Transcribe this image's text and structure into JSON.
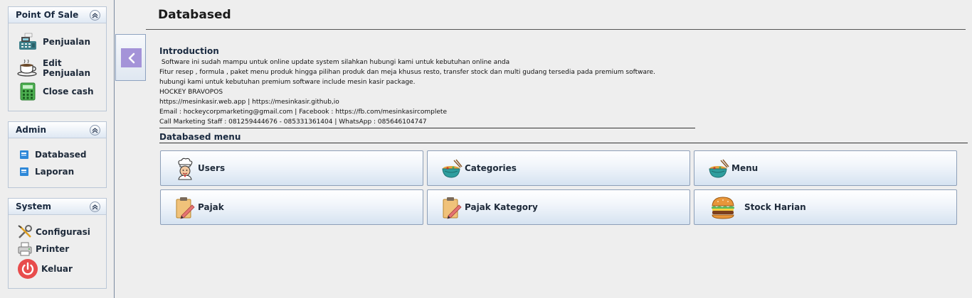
{
  "sidebar": {
    "pos": {
      "title": "Point Of Sale",
      "items": [
        {
          "label": "Penjualan",
          "icon": "cash-register-icon"
        },
        {
          "label": "Edit Penjualan",
          "icon": "coffee-cup-icon"
        },
        {
          "label": "Close cash",
          "icon": "calculator-icon"
        }
      ]
    },
    "admin": {
      "title": "Admin",
      "items": [
        {
          "label": "Databased",
          "icon": "notebook-icon"
        },
        {
          "label": "Laporan",
          "icon": "notebook-icon"
        }
      ]
    },
    "system": {
      "title": "System",
      "items": [
        {
          "label": "Configurasi",
          "icon": "tools-icon"
        },
        {
          "label": "Printer",
          "icon": "printer-icon"
        },
        {
          "label": "Keluar",
          "icon": "power-icon"
        }
      ]
    }
  },
  "page": {
    "title": "Databased",
    "intro_heading": "Introduction",
    "intro_lines": [
      " Software ini sudah mampu untuk online update system silahkan hubungi kami untuk kebutuhan online anda",
      "Fitur resep , formula , paket menu produk hingga pilihan produk dan meja khusus resto, transfer stock dan multi gudang tersedia pada premium software.",
      "hubungi kami untuk kebutuhan premium software include mesin kasir package.",
      "HOCKEY BRAVOPOS",
      "https://mesinkasir.web.app | https://mesinkasir.github,io",
      "Email : hockeycorpmarketing@gmail.com | Facebook : https://fb.com/mesinkasircomplete",
      "Call Marketing Staff : 081259444676 - 085331361404 | WhatsApp : 085646104747"
    ],
    "menu_heading": "Databased menu",
    "menu": [
      {
        "label": "Users",
        "icon": "chef-icon"
      },
      {
        "label": "Categories",
        "icon": "noodle-bowl-icon"
      },
      {
        "label": "Menu",
        "icon": "noodle-bowl-icon"
      },
      {
        "label": "Pajak",
        "icon": "clipboard-pencil-icon"
      },
      {
        "label": "Pajak Kategory",
        "icon": "clipboard-pencil-icon"
      },
      {
        "label": "Stock Harian",
        "icon": "burger-icon"
      }
    ]
  },
  "colors": {
    "accent": "#a493d8",
    "panel_header": "#dfe8f3",
    "rule": "#333333"
  }
}
